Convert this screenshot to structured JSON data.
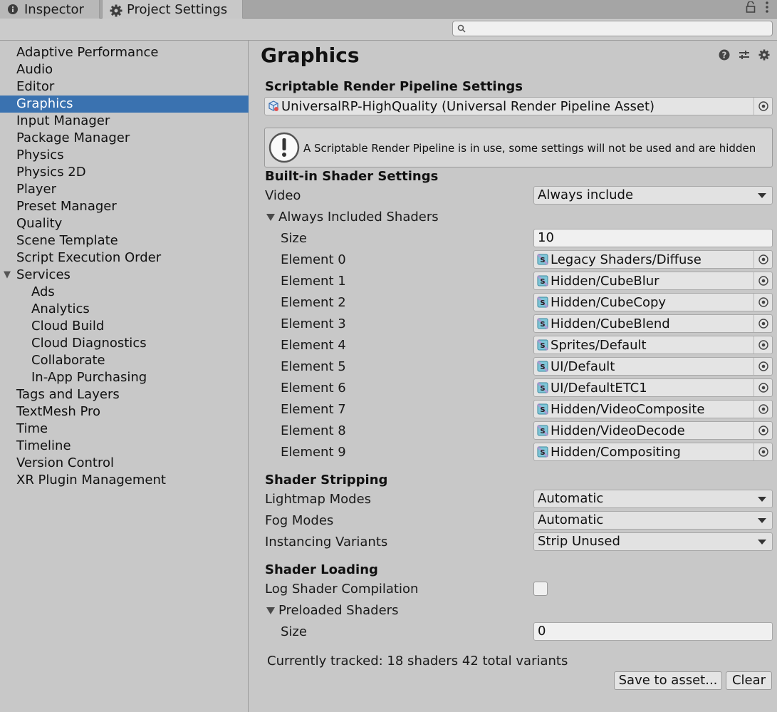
{
  "tabs": [
    {
      "label": "Inspector",
      "icon": "info-icon"
    },
    {
      "label": "Project Settings",
      "icon": "gear-icon"
    }
  ],
  "search": {
    "placeholder": ""
  },
  "sidebar": {
    "items": [
      {
        "label": "Adaptive Performance"
      },
      {
        "label": "Audio"
      },
      {
        "label": "Editor"
      },
      {
        "label": "Graphics",
        "selected": true
      },
      {
        "label": "Input Manager"
      },
      {
        "label": "Package Manager"
      },
      {
        "label": "Physics"
      },
      {
        "label": "Physics 2D"
      },
      {
        "label": "Player"
      },
      {
        "label": "Preset Manager"
      },
      {
        "label": "Quality"
      },
      {
        "label": "Scene Template"
      },
      {
        "label": "Script Execution Order"
      },
      {
        "label": "Services",
        "expanded": true
      },
      {
        "label": "Ads",
        "child": true
      },
      {
        "label": "Analytics",
        "child": true
      },
      {
        "label": "Cloud Build",
        "child": true
      },
      {
        "label": "Cloud Diagnostics",
        "child": true
      },
      {
        "label": "Collaborate",
        "child": true
      },
      {
        "label": "In-App Purchasing",
        "child": true
      },
      {
        "label": "Tags and Layers"
      },
      {
        "label": "TextMesh Pro"
      },
      {
        "label": "Time"
      },
      {
        "label": "Timeline"
      },
      {
        "label": "Version Control"
      },
      {
        "label": "XR Plugin Management"
      }
    ]
  },
  "main": {
    "title": "Graphics",
    "srp": {
      "heading": "Scriptable Render Pipeline Settings",
      "asset": "UniversalRP-HighQuality (Universal Render Pipeline Asset)"
    },
    "warning": "A Scriptable Render Pipeline is in use, some settings will not be used and are hidden",
    "builtin": {
      "heading": "Built-in Shader Settings",
      "video_label": "Video",
      "video_value": "Always include",
      "always_included_label": "Always Included Shaders",
      "size_label": "Size",
      "size_value": "10",
      "elements": [
        {
          "label": "Element 0",
          "value": "Legacy Shaders/Diffuse"
        },
        {
          "label": "Element 1",
          "value": "Hidden/CubeBlur"
        },
        {
          "label": "Element 2",
          "value": "Hidden/CubeCopy"
        },
        {
          "label": "Element 3",
          "value": "Hidden/CubeBlend"
        },
        {
          "label": "Element 4",
          "value": "Sprites/Default"
        },
        {
          "label": "Element 5",
          "value": "UI/Default"
        },
        {
          "label": "Element 6",
          "value": "UI/DefaultETC1"
        },
        {
          "label": "Element 7",
          "value": "Hidden/VideoComposite"
        },
        {
          "label": "Element 8",
          "value": "Hidden/VideoDecode"
        },
        {
          "label": "Element 9",
          "value": "Hidden/Compositing"
        }
      ]
    },
    "stripping": {
      "heading": "Shader Stripping",
      "lightmap_label": "Lightmap Modes",
      "lightmap_value": "Automatic",
      "fog_label": "Fog Modes",
      "fog_value": "Automatic",
      "instancing_label": "Instancing Variants",
      "instancing_value": "Strip Unused"
    },
    "loading": {
      "heading": "Shader Loading",
      "log_label": "Log Shader Compilation",
      "log_checked": false,
      "preloaded_label": "Preloaded Shaders",
      "size_label": "Size",
      "size_value": "0",
      "tracked": "Currently tracked: 18 shaders 42 total variants",
      "save_button": "Save to asset...",
      "clear_button": "Clear"
    }
  },
  "colors": {
    "selection": "#3a72b0",
    "panel_bg": "#c8c8c8",
    "tabbar_bg": "#a5a5a5"
  }
}
